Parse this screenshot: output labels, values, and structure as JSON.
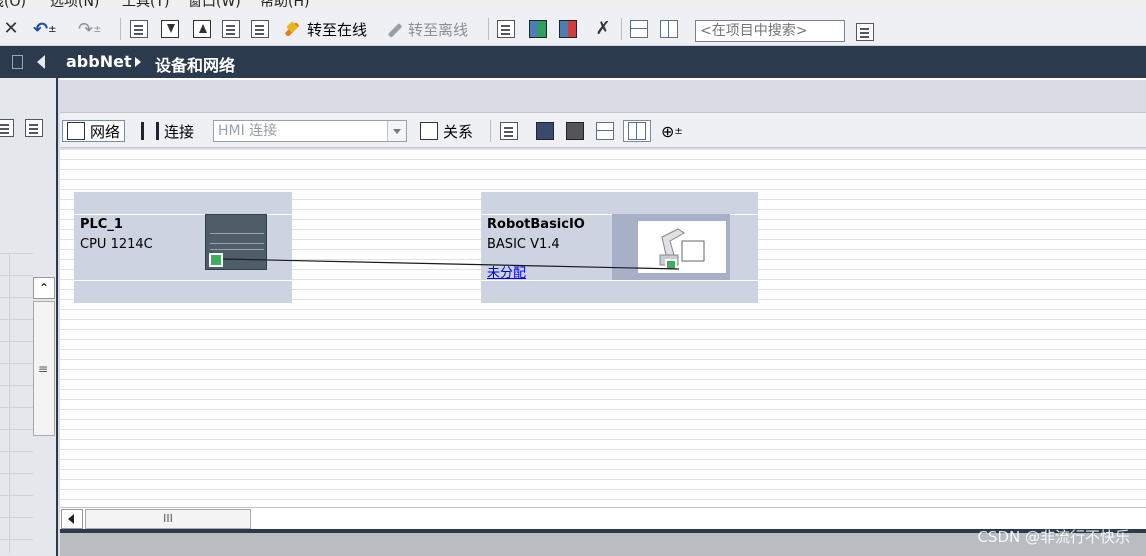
{
  "menu": {
    "items": [
      "线(O)",
      "选项(N)",
      "工具(T)",
      "窗口(W)",
      "帮助(H)"
    ]
  },
  "toolbar": {
    "go_online": "转至在线",
    "go_offline": "转至离线",
    "search_placeholder": "<在项目中搜索>"
  },
  "titlebar": {
    "project": "abbNet",
    "page": "设备和网络"
  },
  "editor_toolbar": {
    "network": "网络",
    "connections": "连接",
    "hmi_connection": "HMI 连接",
    "relations": "关系"
  },
  "devices": [
    {
      "name": "PLC_1",
      "type": "CPU 1214C",
      "link": ""
    },
    {
      "name": "RobotBasicIO",
      "type": "BASIC V1.4",
      "link": "未分配"
    }
  ],
  "scrollbar": {
    "thumb_glyph": "III"
  },
  "left_panel": {
    "grip_glyph": "≡",
    "up_glyph": "⌃"
  },
  "watermark": "CSDN @非流行不快乐",
  "colors": {
    "titlebar_bg": "#2b3a4d",
    "device_bg": "#cdd3e1",
    "port_green": "#3fae5f",
    "online_icon": "#e87c1a"
  },
  "icons": [
    "undo-icon",
    "redo-icon",
    "go-online-icon",
    "go-offline-icon",
    "cross-reference-icon",
    "split-horizontal-icon",
    "split-vertical-icon",
    "zoom-icon"
  ]
}
